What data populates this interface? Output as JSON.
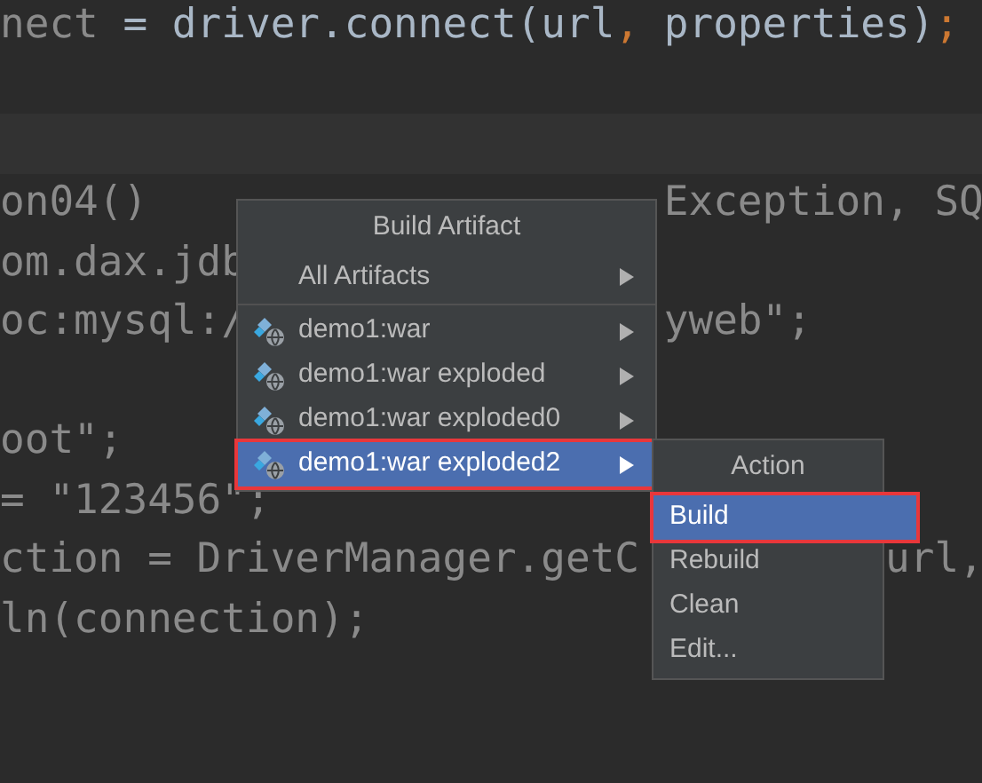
{
  "editor": {
    "lines": [
      {
        "kind": "code",
        "segments": [
          {
            "text": "nect",
            "kind": "dim"
          },
          {
            "text": " = driver.connect(url",
            "kind": "plain"
          },
          {
            "text": ",",
            "kind": "punct"
          },
          {
            "text": " properties)",
            "kind": "plain"
          },
          {
            "text": ";",
            "kind": "punct"
          }
        ]
      },
      {
        "kind": "code"
      },
      {
        "kind": "caret_line"
      },
      {
        "kind": "code",
        "segments": [
          {
            "text": "on04()",
            "kind": "dim"
          },
          {
            "text": "Exception, SQ",
            "kind": "dim"
          }
        ]
      },
      {
        "kind": "code",
        "segments": [
          {
            "text": "om.dax.jdb",
            "kind": "dim"
          }
        ]
      },
      {
        "kind": "code",
        "segments": [
          {
            "text": "oc:mysql:/",
            "kind": "dim"
          },
          {
            "text": "yweb\";",
            "kind": "dim"
          }
        ]
      },
      {
        "kind": "code"
      },
      {
        "kind": "code",
        "segments": [
          {
            "text": "oot\";",
            "kind": "dim"
          }
        ]
      },
      {
        "kind": "code",
        "segments": [
          {
            "text": "= \"123456\";",
            "kind": "dim"
          }
        ]
      },
      {
        "kind": "code",
        "segments": [
          {
            "text": "ction = DriverManager.getC",
            "kind": "dim"
          },
          {
            "text": "url,",
            "kind": "dim"
          }
        ]
      },
      {
        "kind": "code",
        "segments": [
          {
            "text": "ln(connection);",
            "kind": "dim"
          }
        ]
      }
    ]
  },
  "build_menu": {
    "title": "Build Artifact",
    "all_item": {
      "label": "All Artifacts",
      "selected": false
    },
    "artifacts": [
      {
        "label": "demo1:war",
        "selected": false,
        "outlined": false
      },
      {
        "label": "demo1:war exploded",
        "selected": false,
        "outlined": false
      },
      {
        "label": "demo1:war exploded0",
        "selected": false,
        "outlined": false
      },
      {
        "label": "demo1:war exploded2",
        "selected": true,
        "outlined": true
      }
    ]
  },
  "action_menu": {
    "title": "Action",
    "items": [
      {
        "label": "Build",
        "selected": true,
        "outlined": true
      },
      {
        "label": "Rebuild",
        "selected": false,
        "outlined": false
      },
      {
        "label": "Clean",
        "selected": false,
        "outlined": false
      },
      {
        "label": "Edit...",
        "selected": false,
        "outlined": false
      }
    ]
  }
}
